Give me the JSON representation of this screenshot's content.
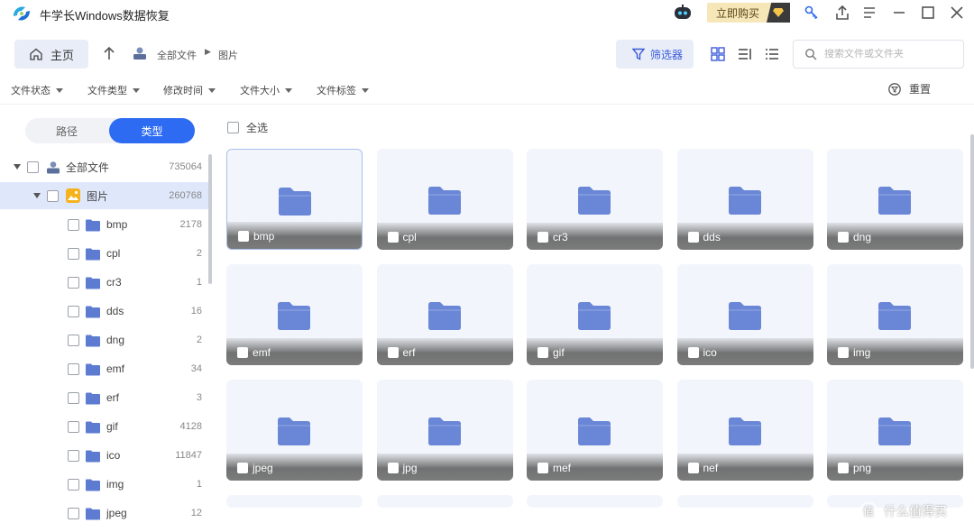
{
  "app": {
    "title": "牛学长Windows数据恢复",
    "buy_label": "立即购买"
  },
  "toolbar": {
    "home_label": "主页",
    "breadcrumb_root": "全部文件",
    "breadcrumb_current": "图片",
    "filter_label": "筛选器",
    "search_placeholder": "搜索文件或文件夹"
  },
  "filterbar": {
    "items": [
      "文件状态",
      "文件类型",
      "修改时间",
      "文件大小",
      "文件标签"
    ],
    "reset_label": "重置"
  },
  "sidebar": {
    "tab_path": "路径",
    "tab_type": "类型",
    "root": {
      "label": "全部文件",
      "count": "735064"
    },
    "category": {
      "label": "图片",
      "count": "260768"
    },
    "items": [
      {
        "label": "bmp",
        "count": "2178"
      },
      {
        "label": "cpl",
        "count": "2"
      },
      {
        "label": "cr3",
        "count": "1"
      },
      {
        "label": "dds",
        "count": "16"
      },
      {
        "label": "dng",
        "count": "2"
      },
      {
        "label": "emf",
        "count": "34"
      },
      {
        "label": "erf",
        "count": "3"
      },
      {
        "label": "gif",
        "count": "4128"
      },
      {
        "label": "ico",
        "count": "11847"
      },
      {
        "label": "img",
        "count": "1"
      },
      {
        "label": "jpeg",
        "count": "12"
      }
    ]
  },
  "main": {
    "select_all_label": "全选",
    "tiles": [
      "bmp",
      "cpl",
      "cr3",
      "dds",
      "dng",
      "emf",
      "erf",
      "gif",
      "ico",
      "img",
      "jpeg",
      "jpg",
      "mef",
      "nef",
      "png"
    ]
  },
  "watermark": {
    "text": "什么值得买"
  },
  "colors": {
    "accent": "#2d6bf2",
    "folder": "#6a86d6",
    "selected_row": "#dfe8fb",
    "tile_bg": "#f2f6fc"
  }
}
